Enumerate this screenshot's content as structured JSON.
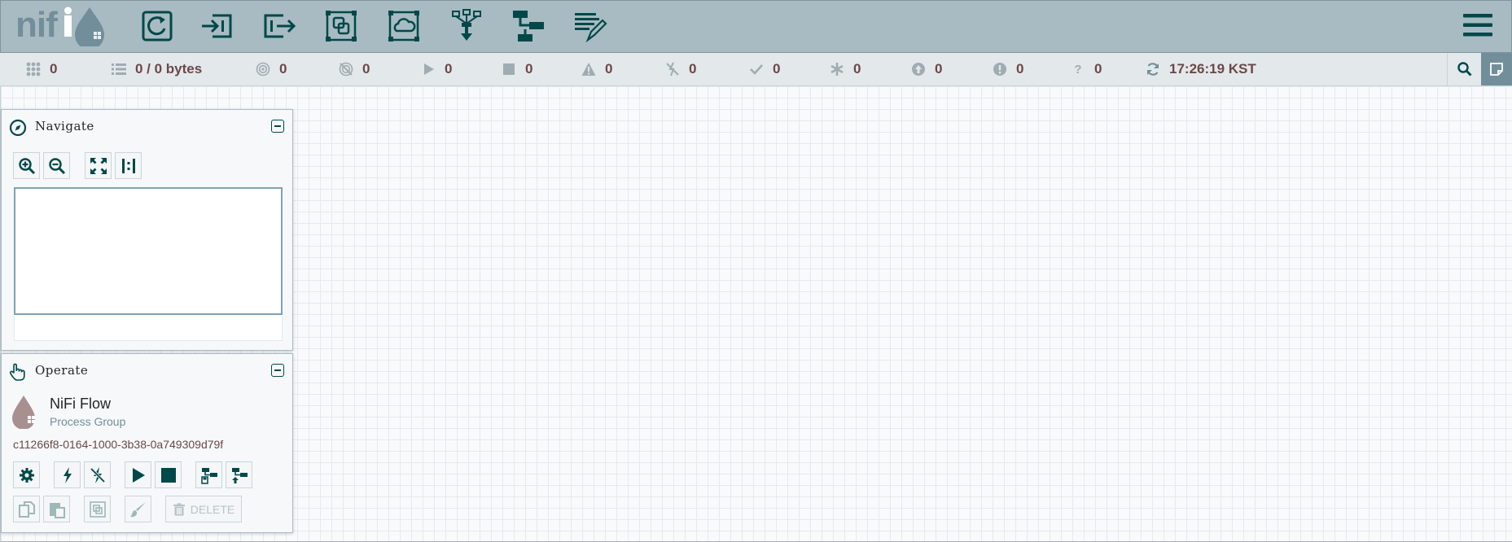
{
  "header": {
    "logo_text": "nifi",
    "tools": [
      {
        "name": "processor-tool",
        "icon": "processor-icon"
      },
      {
        "name": "input-port-tool",
        "icon": "input-port-icon"
      },
      {
        "name": "output-port-tool",
        "icon": "output-port-icon"
      },
      {
        "name": "process-group-tool",
        "icon": "process-group-icon"
      },
      {
        "name": "remote-process-group-tool",
        "icon": "remote-process-group-icon"
      },
      {
        "name": "funnel-tool",
        "icon": "funnel-icon"
      },
      {
        "name": "template-tool",
        "icon": "template-icon"
      },
      {
        "name": "label-tool",
        "icon": "label-icon"
      }
    ]
  },
  "status": {
    "active_threads": "0",
    "queued": "0 / 0 bytes",
    "transmitting": "0",
    "not_transmitting": "0",
    "running": "0",
    "stopped": "0",
    "invalid": "0",
    "disabled": "0",
    "up_to_date": "0",
    "locally_modified": "0",
    "stale": "0",
    "locally_modified_stale": "0",
    "sync_failure": "0",
    "refresh_time": "17:26:19 KST"
  },
  "navigate": {
    "title": "Navigate"
  },
  "operate": {
    "title": "Operate",
    "component_name": "NiFi Flow",
    "component_type": "Process Group",
    "component_id": "c11266f8-0164-1000-3b38-0a749309d79f",
    "delete_label": "DELETE"
  },
  "colors": {
    "header_bg": "#a8bbc2",
    "icon_dark": "#004849",
    "status_value": "#6b4848",
    "canvas_bg": "#f9fafb"
  }
}
